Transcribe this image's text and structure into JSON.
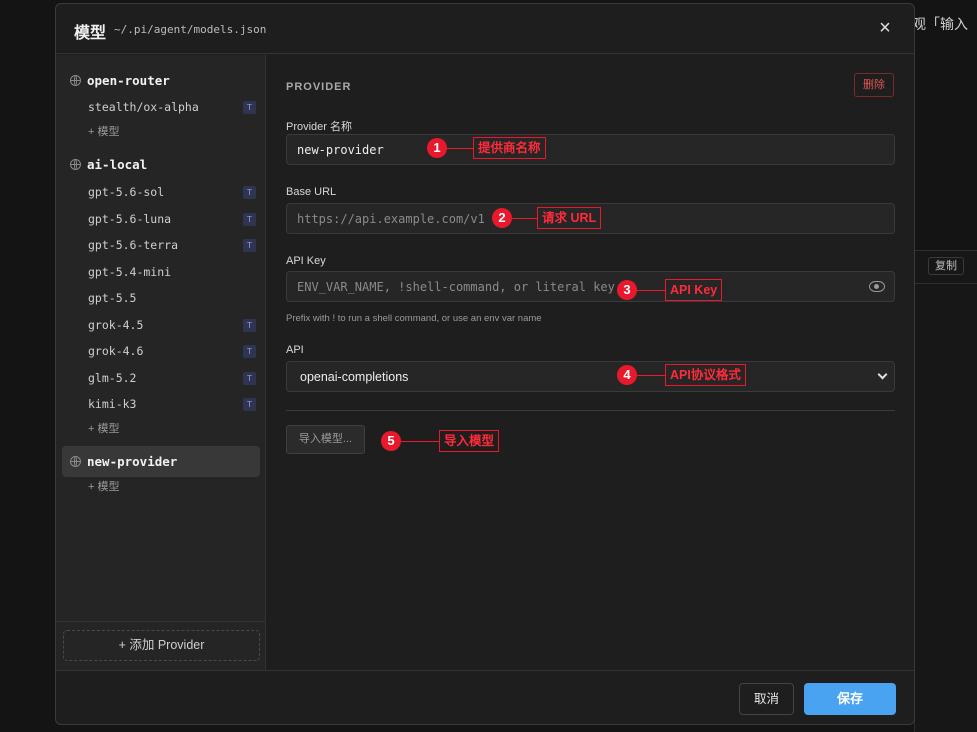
{
  "background": {
    "right_text": "观「输入",
    "copy_label": "复制"
  },
  "modal": {
    "title": "模型",
    "path": "~/.pi/agent/models.json"
  },
  "sidebar": {
    "providers": [
      {
        "label": "open-router",
        "models": [
          {
            "label": "stealth/ox-alpha",
            "badge": "T"
          }
        ],
        "add_model": "+ 模型"
      },
      {
        "label": "ai-local",
        "models": [
          {
            "label": "gpt-5.6-sol",
            "badge": "T"
          },
          {
            "label": "gpt-5.6-luna",
            "badge": "T"
          },
          {
            "label": "gpt-5.6-terra",
            "badge": "T"
          },
          {
            "label": "gpt-5.4-mini",
            "badge": ""
          },
          {
            "label": "gpt-5.5",
            "badge": ""
          },
          {
            "label": "grok-4.5",
            "badge": "T"
          },
          {
            "label": "grok-4.6",
            "badge": "T"
          },
          {
            "label": "glm-5.2",
            "badge": "T"
          },
          {
            "label": "kimi-k3",
            "badge": "T"
          }
        ],
        "add_model": "+ 模型"
      },
      {
        "label": "new-provider",
        "models": [],
        "add_model": "+ 模型"
      }
    ],
    "add_provider": "+ 添加 Provider"
  },
  "form": {
    "section_title": "PROVIDER",
    "delete_label": "删除",
    "provider_name_label": "Provider 名称",
    "provider_name_value": "new-provider",
    "base_url_label": "Base URL",
    "base_url_value": "https://api.example.com/v1",
    "api_key_label": "API Key",
    "api_key_placeholder": "ENV_VAR_NAME, !shell-command, or literal key",
    "api_key_hint": "Prefix with ! to run a shell command, or use an env var name",
    "api_label": "API",
    "api_value": "openai-completions",
    "import_label": "导入模型..."
  },
  "annotations": [
    {
      "num": "1",
      "text": "提供商名称"
    },
    {
      "num": "2",
      "text": "请求 URL"
    },
    {
      "num": "3",
      "text": "API Key"
    },
    {
      "num": "4",
      "text": "API协议格式"
    },
    {
      "num": "5",
      "text": "导入模型"
    }
  ],
  "footer": {
    "cancel_label": "取消",
    "save_label": "保存"
  },
  "colors": {
    "accent": "#4aa3f0",
    "annotation_red": "#e8192c",
    "danger": "#e05555"
  }
}
